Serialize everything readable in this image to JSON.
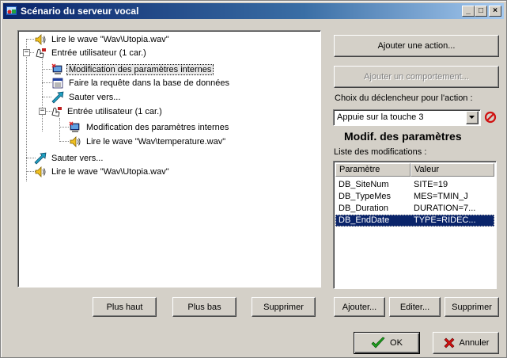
{
  "window": {
    "title": "Scénario du serveur vocal",
    "minimize": "_",
    "maximize": "□",
    "close": "×"
  },
  "tree": {
    "nodes": [
      {
        "label": "Lire le wave \"Wav\\Utopia.wav\"",
        "icon": "speaker-icon"
      },
      {
        "label": "Entrée utilisateur (1 car.)",
        "icon": "hand-phone-icon"
      },
      {
        "label": "Modification des paramètres internes",
        "icon": "computer-icon"
      },
      {
        "label": "Faire la requête dans la base de données",
        "icon": "database-icon"
      },
      {
        "label": "Sauter vers...",
        "icon": "jump-arrow-icon"
      },
      {
        "label": "Entrée utilisateur (1 car.)",
        "icon": "hand-phone-icon"
      },
      {
        "label": "Modification des paramètres internes",
        "icon": "computer-icon"
      },
      {
        "label": "Lire le wave \"Wav\\temperature.wav\"",
        "icon": "speaker-icon"
      },
      {
        "label": "Sauter vers...",
        "icon": "jump-arrow-icon"
      },
      {
        "label": "Lire le wave \"Wav\\Utopia.wav\"",
        "icon": "speaker-icon"
      }
    ],
    "expander_minus": "−"
  },
  "left_buttons": {
    "up": "Plus haut",
    "down": "Plus bas",
    "delete": "Supprimer"
  },
  "right_panel": {
    "add_action": "Ajouter une action...",
    "add_behavior": "Ajouter un comportement...",
    "trigger_label": "Choix du déclencheur pour l'action :",
    "trigger_value": "Appuie sur la touche 3",
    "section_title": "Modif. des paramètres",
    "list_label": "Liste des modifications :",
    "columns": [
      "Paramètre",
      "Valeur"
    ],
    "rows": [
      {
        "param": "DB_SiteNum",
        "value": "SITE=19"
      },
      {
        "param": "DB_TypeMes",
        "value": "MES=TMIN_J"
      },
      {
        "param": "DB_Duration",
        "value": "DURATION=7..."
      },
      {
        "param": "DB_EndDate",
        "value": "TYPE=RIDEC..."
      }
    ],
    "add": "Ajouter...",
    "edit": "Editer...",
    "delete": "Supprimer"
  },
  "footer": {
    "ok": "OK",
    "cancel": "Annuler"
  },
  "colors": {
    "titlebar_start": "#0a246a",
    "selection": "#0a246a",
    "face": "#d4d0c8"
  }
}
